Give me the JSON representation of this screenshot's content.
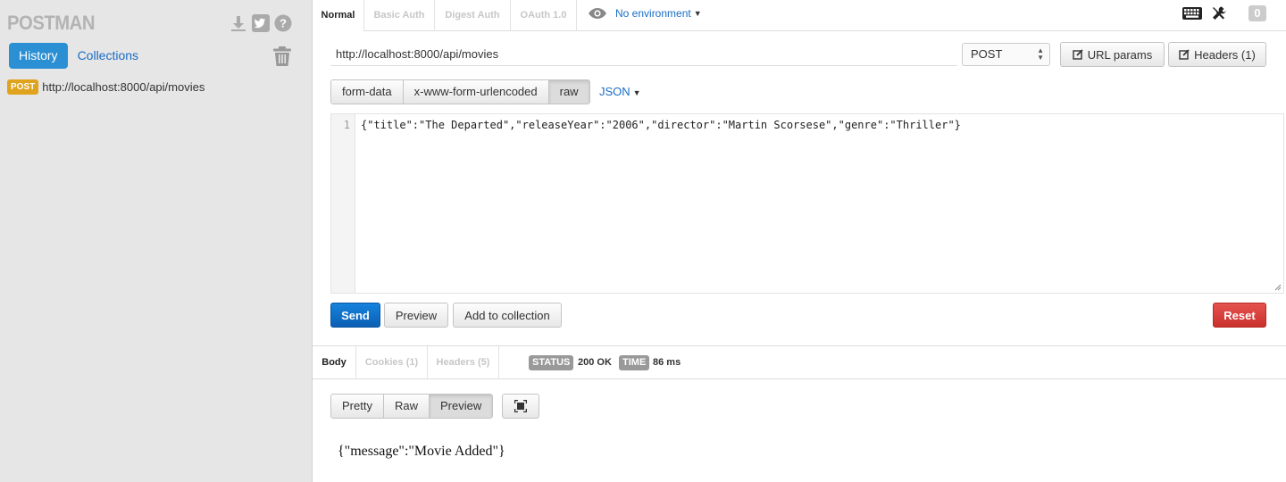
{
  "sidebar": {
    "logo": "POSTMAN",
    "tabs": [
      "History",
      "Collections"
    ],
    "history": [
      {
        "method": "POST",
        "url": "http://localhost:8000/api/movies"
      }
    ]
  },
  "top_tabs": [
    "Normal",
    "Basic Auth",
    "Digest Auth",
    "OAuth 1.0"
  ],
  "environment": "No environment",
  "notification_count": "0",
  "request": {
    "url": "http://localhost:8000/api/movies",
    "method": "POST",
    "url_params_label": "URL params",
    "headers_label": "Headers (1)"
  },
  "body_modes": [
    "form-data",
    "x-www-form-urlencoded",
    "raw"
  ],
  "raw_format": "JSON",
  "editor": {
    "line_number": "1",
    "code": "{\"title\":\"The Departed\",\"releaseYear\":\"2006\",\"director\":\"Martin Scorsese\",\"genre\":\"Thriller\"}"
  },
  "actions": {
    "send": "Send",
    "preview": "Preview",
    "add_to_collection": "Add to collection",
    "reset": "Reset"
  },
  "response": {
    "tabs": [
      "Body",
      "Cookies (1)",
      "Headers (5)"
    ],
    "status_label": "STATUS",
    "status_value": "200 OK",
    "time_label": "TIME",
    "time_value": "86 ms",
    "view_modes": [
      "Pretty",
      "Raw",
      "Preview"
    ],
    "body": "{\"message\":\"Movie Added\"}"
  },
  "colors": {
    "primary": "#2b8fd3",
    "send": "#0b6cc6",
    "reset": "#d9403b",
    "post_badge": "#e0a31e"
  }
}
